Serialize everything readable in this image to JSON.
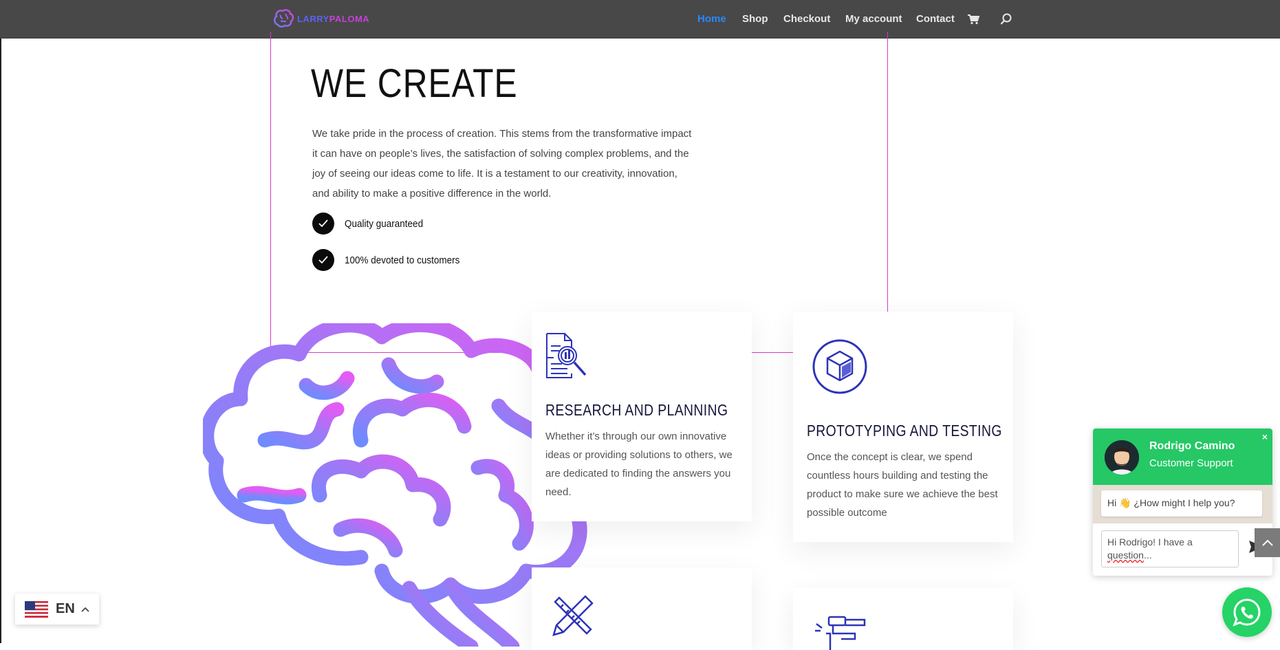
{
  "header": {
    "logo": {
      "text_a": "LARRY",
      "text_b": "PALOMA"
    },
    "nav": [
      {
        "label": "Home",
        "active": true
      },
      {
        "label": "Shop",
        "active": false
      },
      {
        "label": "Checkout",
        "active": false
      },
      {
        "label": "My account",
        "active": false
      },
      {
        "label": "Contact",
        "active": false
      }
    ],
    "icons": [
      "cart-icon",
      "search-icon"
    ]
  },
  "hero": {
    "title": "WE CREATE",
    "paragraph": "We take pride in the process of creation. This stems from the transformative impact it can have on people’s lives, the satisfaction of solving complex problems, and the joy of seeing our ideas come to life. It is a testament to our creativity, innovation, and ability to make a positive difference in the world.",
    "checks": [
      "Quality guaranteed",
      "100% devoted to customers"
    ]
  },
  "cards": [
    {
      "icon": "research-document-magnifier-icon",
      "title": "RESEARCH AND PLANNING",
      "text": "Whether it’s through our own innovative ideas or providing solutions to others, we are dedicated to finding the answers you need."
    },
    {
      "icon": "cube-circle-icon",
      "title": "PROTOTYPING AND TESTING",
      "text": "Once the concept is clear, we spend countless hours building and testing the product to make sure we achieve the best possible outcome"
    },
    {
      "icon": "pencil-ruler-icon",
      "title": "",
      "text": ""
    },
    {
      "icon": "tools-icon",
      "title": "",
      "text": ""
    }
  ],
  "chat": {
    "name": "Rodrigo Camino",
    "role": "Customer Support",
    "greeting": "Hi 👋 ¿How might I help you?",
    "input_line1": "Hi Rodrigo! I have a",
    "input_line2a": "question",
    "input_line2b": "..."
  },
  "language": {
    "code": "EN",
    "flag": "us-flag-icon"
  },
  "colors": {
    "topbar": "#484848",
    "active_nav": "#2b87ff",
    "accent_outline": "#d63ac9",
    "whatsapp": "#25d366",
    "icon_blue": "#2d33b8"
  }
}
